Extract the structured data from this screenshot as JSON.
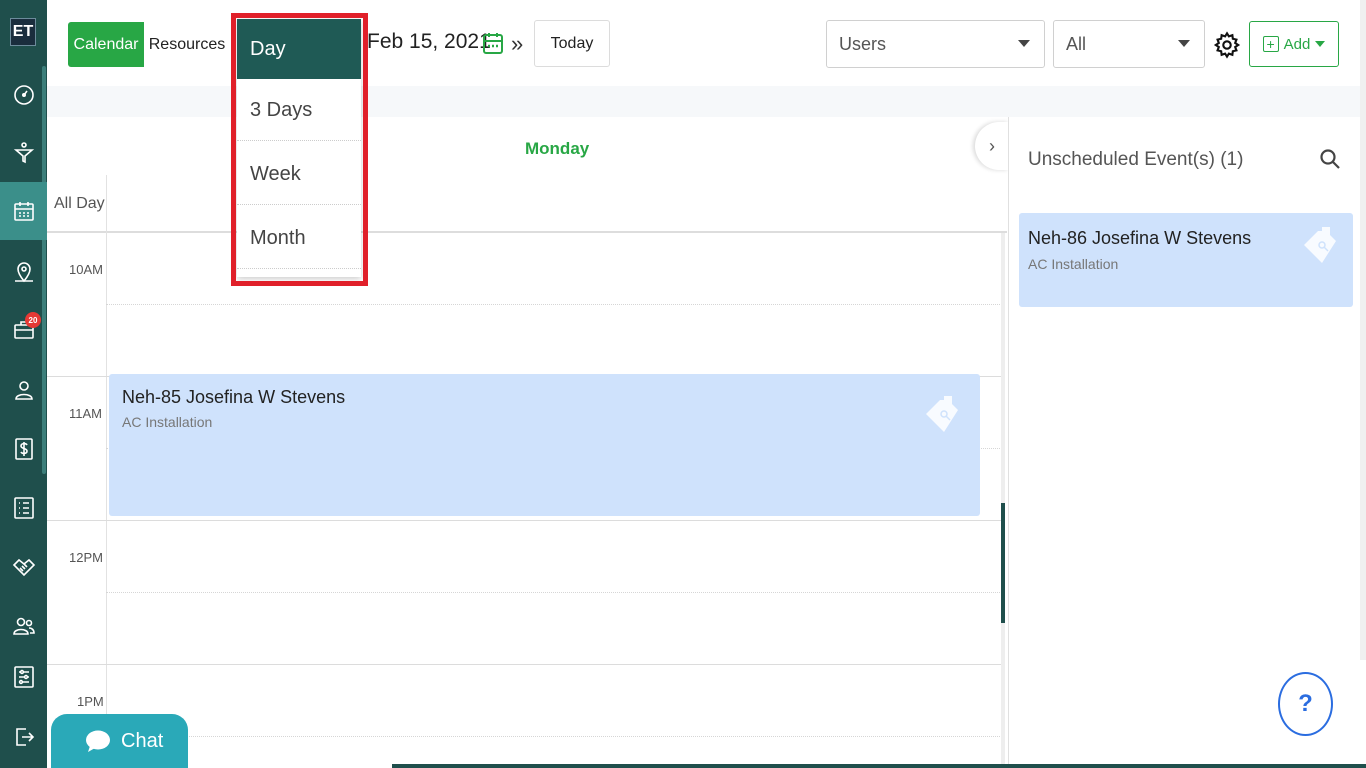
{
  "sidebar": {
    "logo": "ET",
    "badge_count": "20",
    "items": [
      {
        "name": "dashboard-icon"
      },
      {
        "name": "funnel-icon"
      },
      {
        "name": "calendar-icon",
        "active": true
      },
      {
        "name": "map-pin-icon"
      },
      {
        "name": "briefcase-icon"
      },
      {
        "name": "user-icon"
      },
      {
        "name": "dollar-icon"
      },
      {
        "name": "list-icon"
      },
      {
        "name": "handshake-icon"
      },
      {
        "name": "users-icon"
      },
      {
        "name": "settings-sliders-icon"
      },
      {
        "name": "logout-icon"
      }
    ]
  },
  "toolbar": {
    "calendar_label": "Calendar",
    "resources_label": "Resources",
    "date_label": "Feb 15, 2021",
    "next_label": "»",
    "today_label": "Today",
    "users_select": "Users",
    "all_select": "All",
    "add_label": "Add"
  },
  "view_menu": {
    "items": [
      "Day",
      "3 Days",
      "Week",
      "Month"
    ],
    "selected": "Day"
  },
  "calendar": {
    "day_header": "Monday",
    "all_day_label": "All Day",
    "time_labels": [
      "10AM",
      "11AM",
      "12PM",
      "1PM"
    ],
    "event": {
      "title": "Neh-85 Josefina W Stevens",
      "subtitle": "AC Installation"
    }
  },
  "right_panel": {
    "title": "Unscheduled Event(s) (1)",
    "event": {
      "title": "Neh-86 Josefina W Stevens",
      "subtitle": "AC Installation"
    }
  },
  "help_label": "?",
  "chat_label": "Chat",
  "colors": {
    "sidebar": "#1f4f4c",
    "accent_green": "#28a745",
    "event_bg": "#cfe2fc",
    "highlight": "#e0202a"
  }
}
